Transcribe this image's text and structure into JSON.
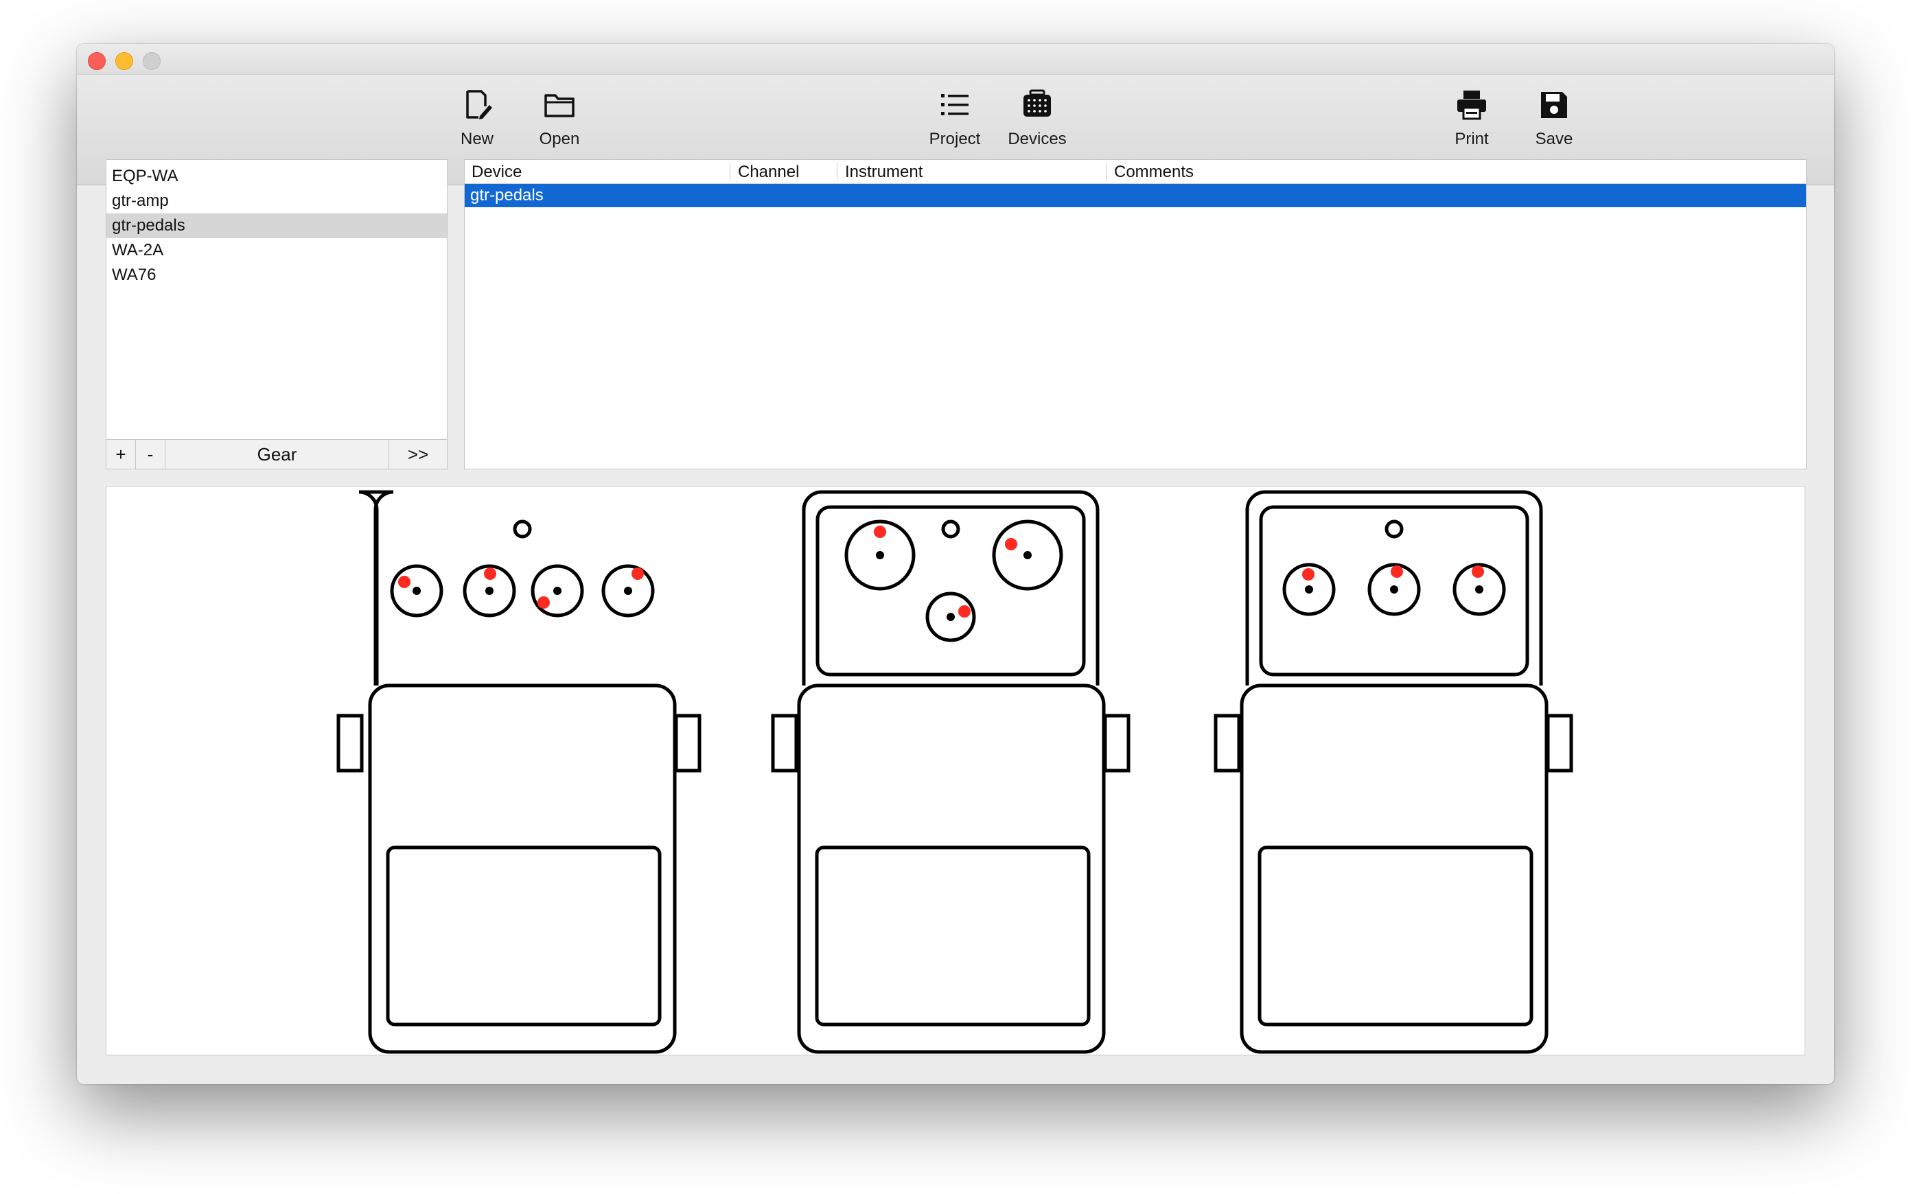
{
  "toolbar": {
    "new_label": "New",
    "open_label": "Open",
    "project_label": "Project",
    "devices_label": "Devices",
    "print_label": "Print",
    "save_label": "Save"
  },
  "gear": {
    "items": [
      "EQP-WA",
      "gtr-amp",
      "gtr-pedals",
      "WA-2A",
      "WA76"
    ],
    "selected": "gtr-pedals",
    "add_label": "+",
    "remove_label": "-",
    "title": "Gear",
    "more_label": ">>"
  },
  "table": {
    "columns": [
      "Device",
      "Channel",
      "Instrument",
      "Comments"
    ],
    "rows": [
      {
        "device": "gtr-pedals",
        "channel": "",
        "instrument": "",
        "comments": ""
      }
    ]
  },
  "pedals": [
    {
      "layout": "four-knob",
      "knob_count": 4
    },
    {
      "layout": "three-knob-triangle",
      "knob_count": 3
    },
    {
      "layout": "three-knob-row",
      "knob_count": 3
    }
  ],
  "colors": {
    "selection": "#1268d3",
    "knob_indicator": "#ff2a1f",
    "outline": "#000000"
  }
}
